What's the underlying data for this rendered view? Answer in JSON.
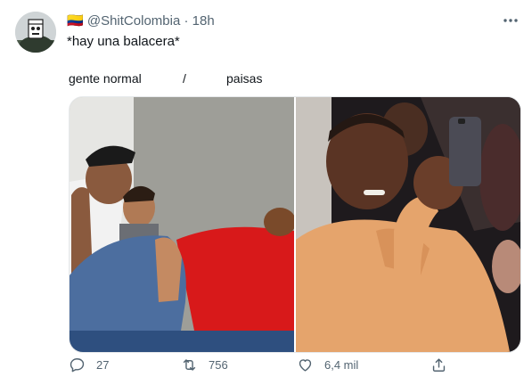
{
  "tweet": {
    "author_name": "🇨🇴",
    "handle": "@ShitColombia",
    "separator": "·",
    "time": "18h",
    "text": "*hay una balacera*",
    "caption_left": "gente normal",
    "caption_sep": "/",
    "caption_right": "paisas",
    "more_icon": "more-horizontal-icon",
    "actions": {
      "replies": "27",
      "retweets": "756",
      "likes": "6,4 mil"
    }
  },
  "colors": {
    "muted": "#536471",
    "text": "#0f1419",
    "border": "#e6e9eb"
  }
}
